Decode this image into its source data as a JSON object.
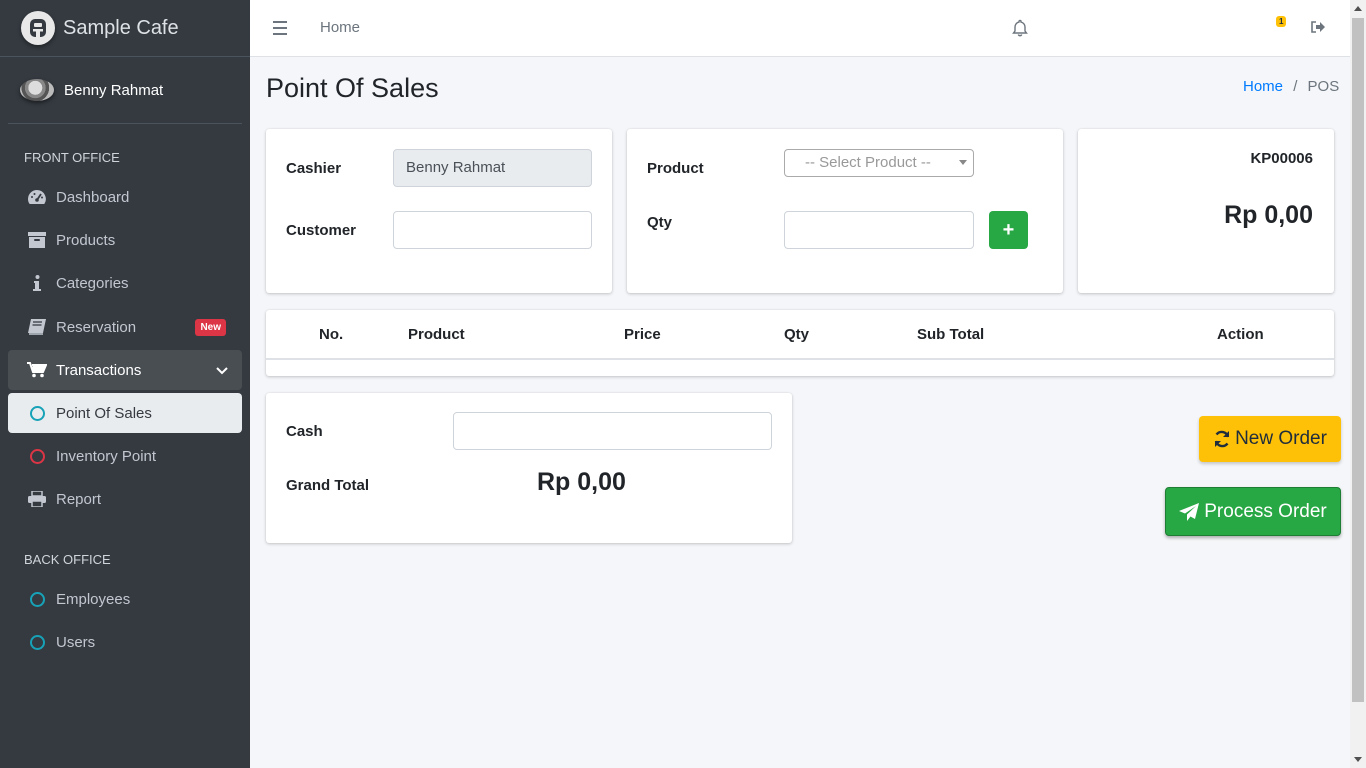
{
  "app": {
    "brand": "Sample Cafe"
  },
  "user": {
    "name": "Benny Rahmat"
  },
  "sidebar": {
    "front_office_header": "FRONT OFFICE",
    "items": [
      {
        "label": "Dashboard",
        "icon": "tachometer-icon"
      },
      {
        "label": "Products",
        "icon": "archive-icon"
      },
      {
        "label": "Categories",
        "icon": "info-icon"
      },
      {
        "label": "Reservation",
        "icon": "book-icon",
        "badge": "New"
      },
      {
        "label": "Transactions",
        "icon": "cart-icon"
      },
      {
        "label": "Point Of Sales",
        "icon": "circle-icon"
      },
      {
        "label": "Inventory Point",
        "icon": "circle-icon"
      },
      {
        "label": "Report",
        "icon": "print-icon"
      }
    ],
    "back_office_header": "BACK OFFICE",
    "back_items": [
      {
        "label": "Employees",
        "icon": "circle-icon"
      },
      {
        "label": "Users",
        "icon": "circle-icon"
      }
    ]
  },
  "topbar": {
    "home": "Home",
    "notification_count": "1"
  },
  "page": {
    "title": "Point Of Sales",
    "breadcrumb": {
      "home": "Home",
      "separator": "/",
      "current": "POS"
    }
  },
  "cashier_card": {
    "cashier_label": "Cashier",
    "cashier_value": "Benny Rahmat",
    "customer_label": "Customer",
    "customer_value": ""
  },
  "product_card": {
    "product_label": "Product",
    "product_placeholder": "-- Select Product --",
    "qty_label": "Qty",
    "qty_value": "",
    "add_button": "+"
  },
  "invoice_card": {
    "code": "KP00006",
    "total": "Rp 0,00"
  },
  "table": {
    "headers": [
      "No.",
      "Product",
      "Price",
      "Qty",
      "Sub Total",
      "Action"
    ],
    "rows": []
  },
  "payment_card": {
    "cash_label": "Cash",
    "cash_value": "",
    "grand_total_label": "Grand Total",
    "grand_total_value": "Rp 0,00"
  },
  "actions": {
    "new_order": "New Order",
    "process_order": "Process Order"
  },
  "colors": {
    "sidebar": "#343a40",
    "primary": "#007bff",
    "success": "#28a745",
    "warning": "#ffc107",
    "danger": "#dc3545",
    "info": "#17a2b8"
  }
}
